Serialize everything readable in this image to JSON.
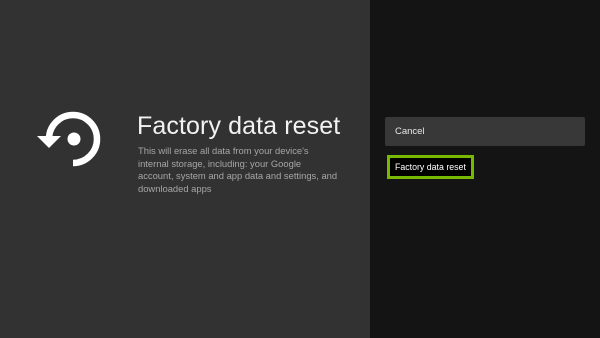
{
  "dialog": {
    "icon": "restore-icon",
    "title": "Factory data reset",
    "description": "This will erase all data from your device's internal storage, including: your Google account, system and app data and settings, and downloaded apps"
  },
  "actions": {
    "cancel_label": "Cancel",
    "reset_label": "Factory data reset",
    "focused": "reset",
    "focus_color": "#76b900"
  },
  "colors": {
    "left_panel": "#323232",
    "right_panel": "#141414",
    "cancel_button": "#383838"
  }
}
